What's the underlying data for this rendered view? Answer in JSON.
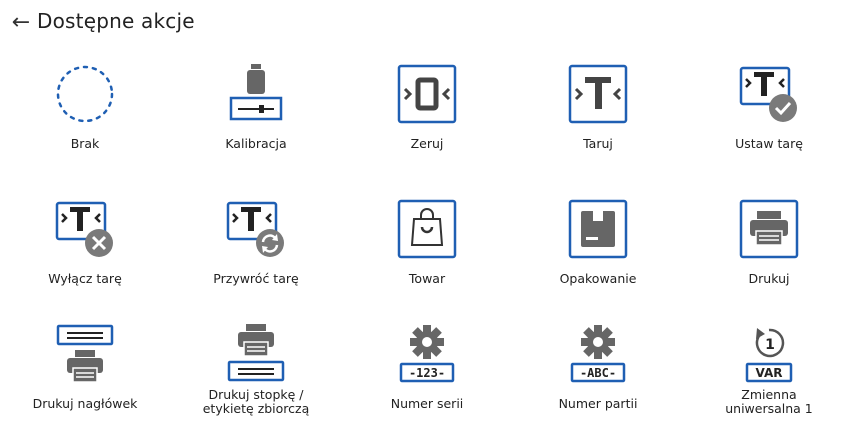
{
  "header": {
    "title": "Dostępne akcje",
    "back_icon": "arrow-left-icon"
  },
  "colors": {
    "accent": "#1f5fb3",
    "grey": "#666666",
    "text": "#222222",
    "badge": "#777777"
  },
  "actions": [
    {
      "label": "Brak",
      "icon": "empty-dashed-circle-icon"
    },
    {
      "label": "Kalibracja",
      "icon": "weight-calibration-icon"
    },
    {
      "label": "Zeruj",
      "icon": "zero-icon"
    },
    {
      "label": "Taruj",
      "icon": "tare-icon"
    },
    {
      "label": "Ustaw tarę",
      "icon": "set-tare-icon"
    },
    {
      "label": "Wyłącz tarę",
      "icon": "disable-tare-icon"
    },
    {
      "label": "Przywróć tarę",
      "icon": "restore-tare-icon"
    },
    {
      "label": "Towar",
      "icon": "product-bag-icon"
    },
    {
      "label": "Opakowanie",
      "icon": "packaging-icon"
    },
    {
      "label": "Drukuj",
      "icon": "printer-icon"
    },
    {
      "label": "Drukuj nagłówek",
      "icon": "print-header-icon"
    },
    {
      "label": "Drukuj stopkę / etykietę zbiorczą",
      "icon": "print-footer-icon"
    },
    {
      "label": "Numer serii",
      "icon": "serial-number-icon",
      "badge_text": "-123-"
    },
    {
      "label": "Numer partii",
      "icon": "batch-number-icon",
      "badge_text": "-ABC-"
    },
    {
      "label": "Zmienna uniwersalna 1",
      "icon": "universal-variable-icon",
      "badge_text": "VAR",
      "circle_text": "1"
    }
  ]
}
